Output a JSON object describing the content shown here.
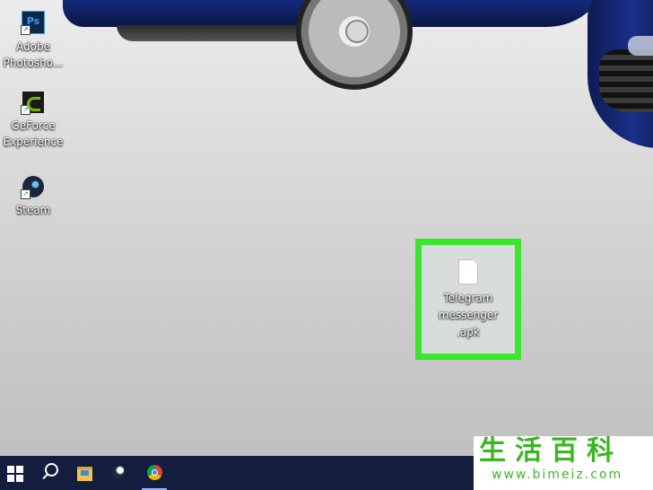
{
  "desktop": {
    "wallpaper": "car-wallpaper",
    "icons": [
      {
        "label": "Adobe\nPhotosho...",
        "line1": "Adobe",
        "line2": "Photosho...",
        "icon": "photoshop-icon"
      },
      {
        "label": "GeForce Experience",
        "line1": "GeForce",
        "line2": "Experience",
        "icon": "geforce-icon"
      },
      {
        "label": "Steam",
        "line1": "Steam",
        "icon": "steam-icon"
      }
    ],
    "ps_glyph": "Ps",
    "file": {
      "line1": "Telegram",
      "line2": "messenger",
      "line3": ".apk",
      "icon": "file-icon",
      "highlight_color": "#39e62b"
    }
  },
  "taskbar": {
    "background": "#131d3d",
    "items": [
      "windows-start-icon",
      "search-icon",
      "file-explorer-icon",
      "steam-icon",
      "chrome-icon"
    ]
  },
  "watermark": {
    "chinese": "生活百科",
    "url": "www.bimeiz.com",
    "color": "#3cb524"
  }
}
